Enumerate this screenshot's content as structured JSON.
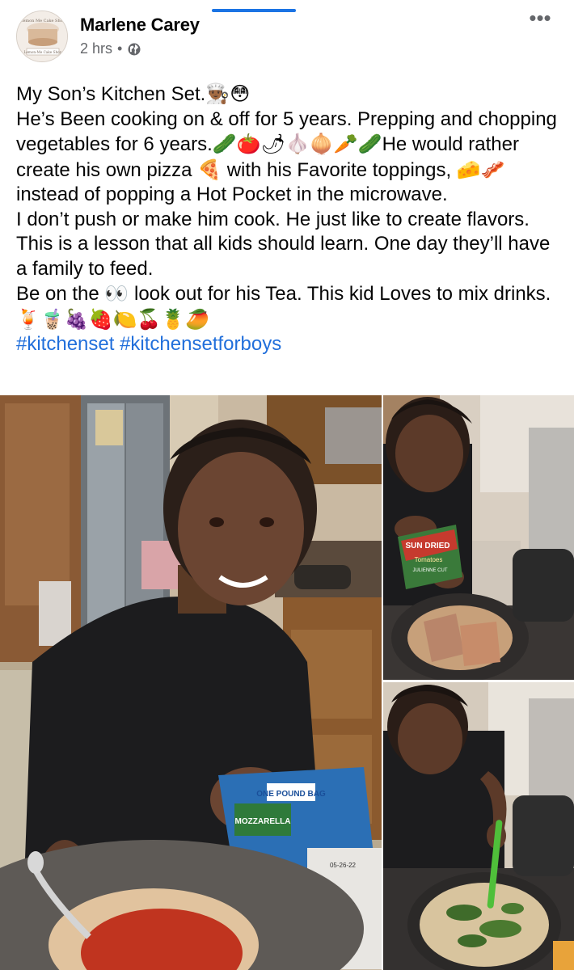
{
  "ui": {
    "active_tab": "photos-indicator"
  },
  "post": {
    "author": "Marlene Carey",
    "time": "2 hrs",
    "separator": "•",
    "audience_icon": "globe-icon",
    "more_icon": "more-options-icon",
    "more_label": "•••",
    "avatar": {
      "type": "cake-shop-logo",
      "text_top": "Lemon Me Cake Shop",
      "text_bottom": "Lemon-Me Cake Shop"
    },
    "lines": [
      "My Son’s Kitchen Set.",
      "He’s Been cooking on & off for 5 years. Prepping and chopping vegetables for 6 years.",
      "He would rather create his own pizza",
      "with his Favorite toppings,",
      "instead of popping a Hot Pocket in the microwave.",
      "I don’t push or make him cook. He just like to create flavors. This is a lesson that all kids should learn. One day they’ll have a family to feed.",
      "Be on the",
      "look out for his Tea. This kid Loves to mix drinks."
    ],
    "emojis": {
      "title": "👨🏾‍🍳😳",
      "vegetables": "🥒🍅🌶🧄🧅🥕🥒",
      "pizza": "🍕",
      "toppings": "🧀🥓",
      "eyes": "👀",
      "drinks": "🍹🧋🍇🍓🍋🍒🍍🥭"
    },
    "hashtags": [
      "#kitchenset",
      "#kitchensetforboys"
    ]
  },
  "photos": {
    "main": {
      "subject": "boy-smiling-making-pizza",
      "package_label": "MOZZARELLA",
      "package_tag": "ONE POUND BAG",
      "bag_date": "05-26-22"
    },
    "top_right": {
      "subject": "boy-adding-sun-dried-tomatoes",
      "package_label_1": "SUN DRIED",
      "package_label_2": "Tomatoes",
      "package_label_3": "JULIENNE CUT"
    },
    "bottom_right": {
      "subject": "boy-stirring-creamy-spinach-pan"
    }
  },
  "colors": {
    "link": "#216fdb",
    "secondary_text": "#65676b",
    "tab_indicator": "#1b74e4"
  }
}
